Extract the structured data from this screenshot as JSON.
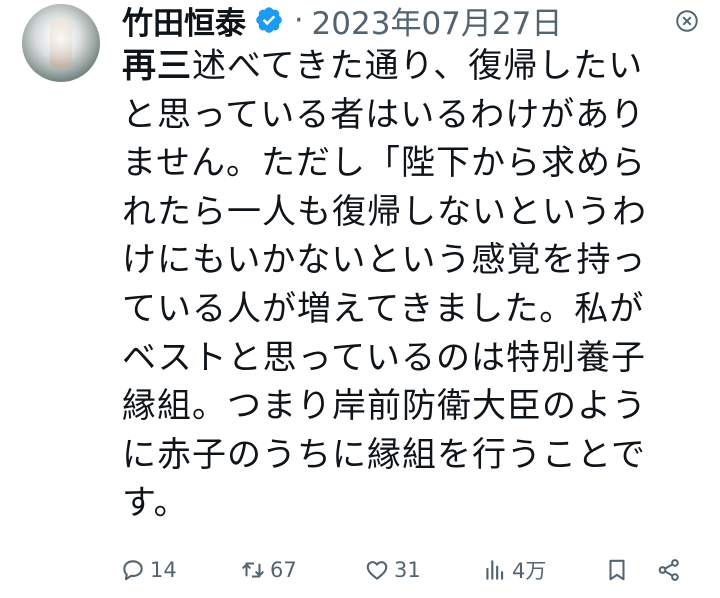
{
  "tweet": {
    "author_name": "竹田恒泰",
    "separator": "·",
    "date": "2023年07月27日",
    "verified_color": "#1d9bf0",
    "avatar_icon": "profile-photo",
    "more_icon": "more-options-icon",
    "body_lines": [
      {
        "bold": "再三",
        "text": "述べてきた通り、復帰したい"
      },
      {
        "bold": "",
        "text": "と思っている者はいるわけがあり"
      },
      {
        "bold": "",
        "text": "ません。ただし「陛下から求めら"
      },
      {
        "bold": "",
        "text": "れたら一人も復帰しないというわ"
      },
      {
        "bold": "",
        "text": "けにもいかないという感覚を持っ"
      },
      {
        "bold": "",
        "text": "ている人が増えてきました。私が"
      },
      {
        "bold": "",
        "text": "ベストと思っているのは特別養子"
      },
      {
        "bold": "",
        "text": "縁組。つまり岸前防衛大臣のよう"
      },
      {
        "bold": "",
        "text": "に赤子のうちに縁組を行うことで"
      },
      {
        "bold": "",
        "text": "す。"
      }
    ]
  },
  "actions": {
    "reply_count": "14",
    "retweet_count": "67",
    "like_count": "31",
    "views_count": "4万",
    "icons": [
      "reply-icon",
      "retweet-icon",
      "like-icon",
      "views-icon",
      "bookmark-icon",
      "share-icon"
    ],
    "icon_color": "#536471"
  }
}
